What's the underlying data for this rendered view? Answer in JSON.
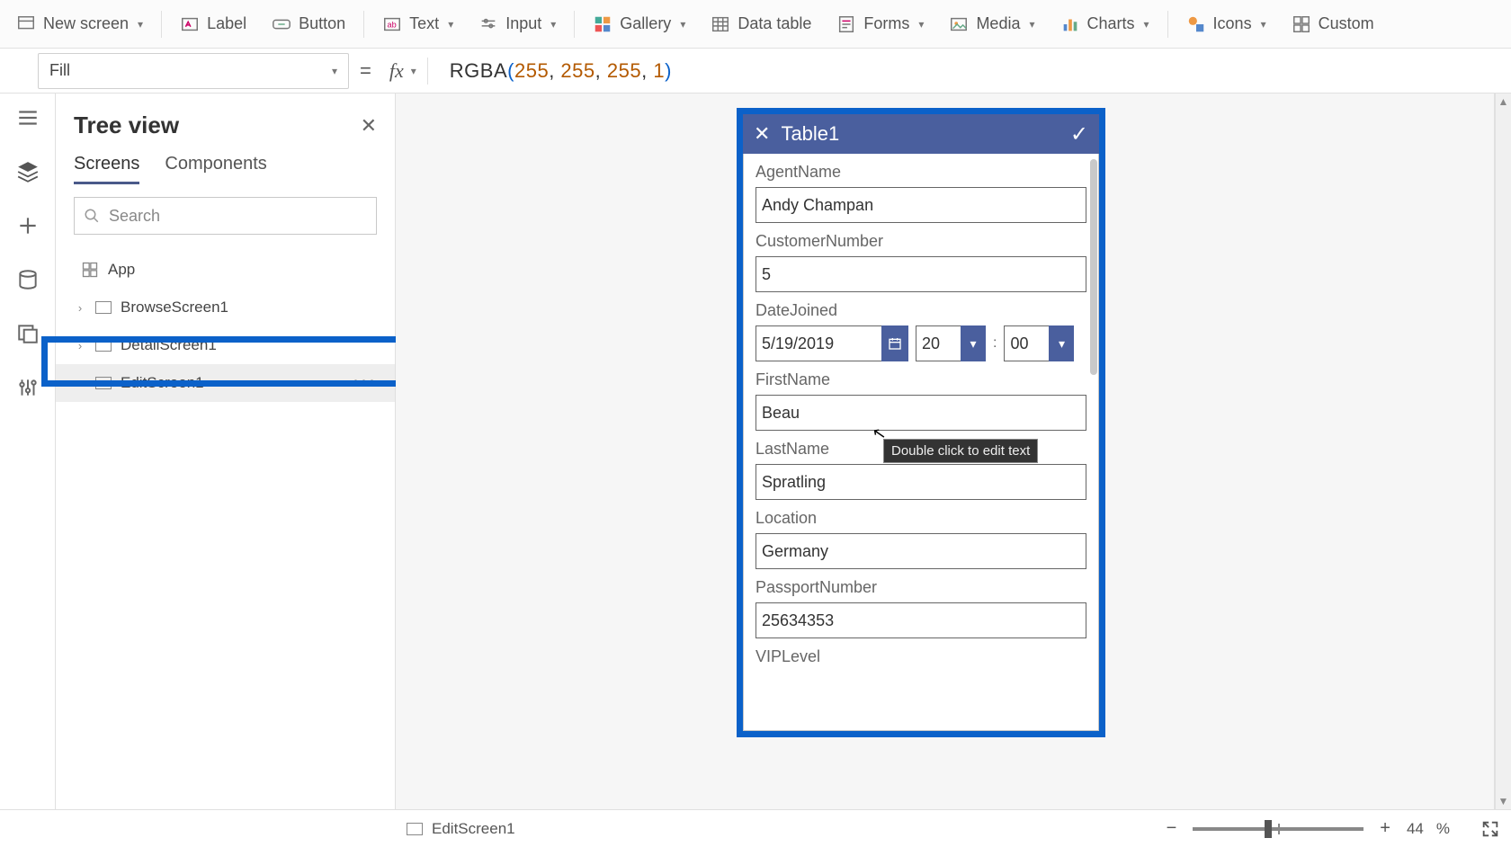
{
  "toolbar": {
    "new_screen": "New screen",
    "label": "Label",
    "button": "Button",
    "text": "Text",
    "input": "Input",
    "gallery": "Gallery",
    "data_table": "Data table",
    "forms": "Forms",
    "media": "Media",
    "charts": "Charts",
    "icons": "Icons",
    "custom": "Custom"
  },
  "formula": {
    "property": "Fill",
    "fn": "RGBA",
    "args": [
      "255",
      "255",
      "255",
      "1"
    ]
  },
  "tree": {
    "title": "Tree view",
    "tabs": {
      "screens": "Screens",
      "components": "Components"
    },
    "search_placeholder": "Search",
    "app_label": "App",
    "items": [
      {
        "label": "BrowseScreen1"
      },
      {
        "label": "DetailScreen1"
      },
      {
        "label": "EditScreen1"
      }
    ]
  },
  "canvas": {
    "form_title": "Table1",
    "tooltip": "Double click to edit text",
    "fields": {
      "agent_name": {
        "label": "AgentName",
        "value": "Andy Champan"
      },
      "customer_number": {
        "label": "CustomerNumber",
        "value": "5"
      },
      "date_joined": {
        "label": "DateJoined",
        "date": "5/19/2019",
        "hour": "20",
        "minute": "00"
      },
      "first_name": {
        "label": "FirstName",
        "value": "Beau"
      },
      "last_name": {
        "label": "LastName",
        "value": "Spratling"
      },
      "location": {
        "label": "Location",
        "value": "Germany"
      },
      "passport_number": {
        "label": "PassportNumber",
        "value": "25634353"
      },
      "vip_level": {
        "label": "VIPLevel"
      }
    }
  },
  "status": {
    "screen": "EditScreen1",
    "zoom_value": "44",
    "zoom_unit": "%"
  }
}
